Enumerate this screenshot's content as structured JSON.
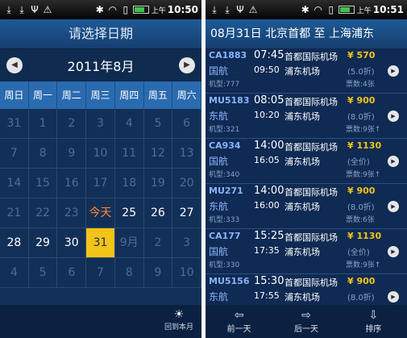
{
  "left_screen": {
    "status_bar": {
      "ampm": "上午",
      "time": "10:50"
    },
    "title": "请选择日期",
    "month_label": "2011年8月",
    "weekdays": [
      "周日",
      "周一",
      "周二",
      "周三",
      "周四",
      "周五",
      "周六"
    ],
    "days": [
      {
        "label": "31",
        "state": "dim"
      },
      {
        "label": "1",
        "state": "dim"
      },
      {
        "label": "2",
        "state": "dim"
      },
      {
        "label": "3",
        "state": "dim"
      },
      {
        "label": "4",
        "state": "dim"
      },
      {
        "label": "5",
        "state": "dim"
      },
      {
        "label": "6",
        "state": "dim"
      },
      {
        "label": "7",
        "state": "dim"
      },
      {
        "label": "8",
        "state": "dim"
      },
      {
        "label": "9",
        "state": "dim"
      },
      {
        "label": "10",
        "state": "dim"
      },
      {
        "label": "11",
        "state": "dim"
      },
      {
        "label": "12",
        "state": "dim"
      },
      {
        "label": "13",
        "state": "dim"
      },
      {
        "label": "14",
        "state": "dim"
      },
      {
        "label": "15",
        "state": "dim"
      },
      {
        "label": "16",
        "state": "dim"
      },
      {
        "label": "17",
        "state": "dim"
      },
      {
        "label": "18",
        "state": "dim"
      },
      {
        "label": "19",
        "state": "dim"
      },
      {
        "label": "20",
        "state": "dim"
      },
      {
        "label": "21",
        "state": "dim"
      },
      {
        "label": "22",
        "state": "dim"
      },
      {
        "label": "23",
        "state": "dim"
      },
      {
        "label": "今天",
        "state": "today"
      },
      {
        "label": "25",
        "state": "cur"
      },
      {
        "label": "26",
        "state": "cur"
      },
      {
        "label": "27",
        "state": "cur"
      },
      {
        "label": "28",
        "state": "cur"
      },
      {
        "label": "29",
        "state": "cur"
      },
      {
        "label": "30",
        "state": "cur"
      },
      {
        "label": "31",
        "state": "sel"
      },
      {
        "label": "9月",
        "state": "dim"
      },
      {
        "label": "2",
        "state": "dim"
      },
      {
        "label": "3",
        "state": "dim"
      },
      {
        "label": "4",
        "state": "dim"
      },
      {
        "label": "5",
        "state": "dim"
      },
      {
        "label": "6",
        "state": "dim"
      },
      {
        "label": "7",
        "state": "dim"
      },
      {
        "label": "8",
        "state": "dim"
      },
      {
        "label": "9",
        "state": "dim"
      },
      {
        "label": "10",
        "state": "dim"
      }
    ],
    "footer": {
      "back_to_month": "回到本月"
    }
  },
  "right_screen": {
    "status_bar": {
      "ampm": "上午",
      "time": "10:51"
    },
    "route_title": "08月31日  北京首都 至 上海浦东",
    "flights": [
      {
        "flight_no": "CA1883",
        "airline": "国航",
        "model": "机型:777",
        "dep_time": "07:45",
        "dep_airport": "首都国际机场",
        "arr_time": "09:50",
        "arr_airport": "浦东机场",
        "price": "¥ 570",
        "discount": "(5.0折)",
        "tickets": "票数:4张"
      },
      {
        "flight_no": "MU5183",
        "airline": "东航",
        "model": "机型:321",
        "dep_time": "08:05",
        "dep_airport": "首都国际机场",
        "arr_time": "10:20",
        "arr_airport": "浦东机场",
        "price": "¥ 900",
        "discount": "(8.0折)",
        "tickets": "票数:9张↑"
      },
      {
        "flight_no": "CA934",
        "airline": "国航",
        "model": "机型:340",
        "dep_time": "14:00",
        "dep_airport": "首都国际机场",
        "arr_time": "16:05",
        "arr_airport": "浦东机场",
        "price": "¥ 1130",
        "discount": "(全价)",
        "tickets": "票数:9张↑"
      },
      {
        "flight_no": "MU271",
        "airline": "东航",
        "model": "机型:333",
        "dep_time": "14:00",
        "dep_airport": "首都国际机场",
        "arr_time": "16:00",
        "arr_airport": "浦东机场",
        "price": "¥ 900",
        "discount": "(8.0折)",
        "tickets": "票数:6张"
      },
      {
        "flight_no": "CA177",
        "airline": "国航",
        "model": "机型:330",
        "dep_time": "15:25",
        "dep_airport": "首都国际机场",
        "arr_time": "17:35",
        "arr_airport": "浦东机场",
        "price": "¥ 1130",
        "discount": "(全价)",
        "tickets": "票数:9张↑"
      },
      {
        "flight_no": "MU5156",
        "airline": "东航",
        "model": "",
        "dep_time": "15:30",
        "dep_airport": "首都国际机场",
        "arr_time": "17:55",
        "arr_airport": "浦东机场",
        "price": "¥ 900",
        "discount": "(8.0折)",
        "tickets": ""
      }
    ],
    "bottom_bar": {
      "prev_day": "前一天",
      "next_day": "后一天",
      "sort": "排序"
    }
  },
  "icons": [
    "download-icon",
    "usb-icon",
    "warning-icon",
    "bluetooth-icon",
    "wifi-icon",
    "sd-card-icon",
    "battery-icon",
    "arrow-left-icon",
    "arrow-right-icon",
    "sun-icon",
    "go-arrow-icon",
    "sort-icon"
  ],
  "colors": {
    "bg": "#123057",
    "header": "#1e5a96",
    "weekday_row": "#2a6bb0",
    "selected_day": "#f2c417",
    "price": "#f2c417",
    "today": "#ff8a3a",
    "flight_no": "#8ab4ff"
  }
}
